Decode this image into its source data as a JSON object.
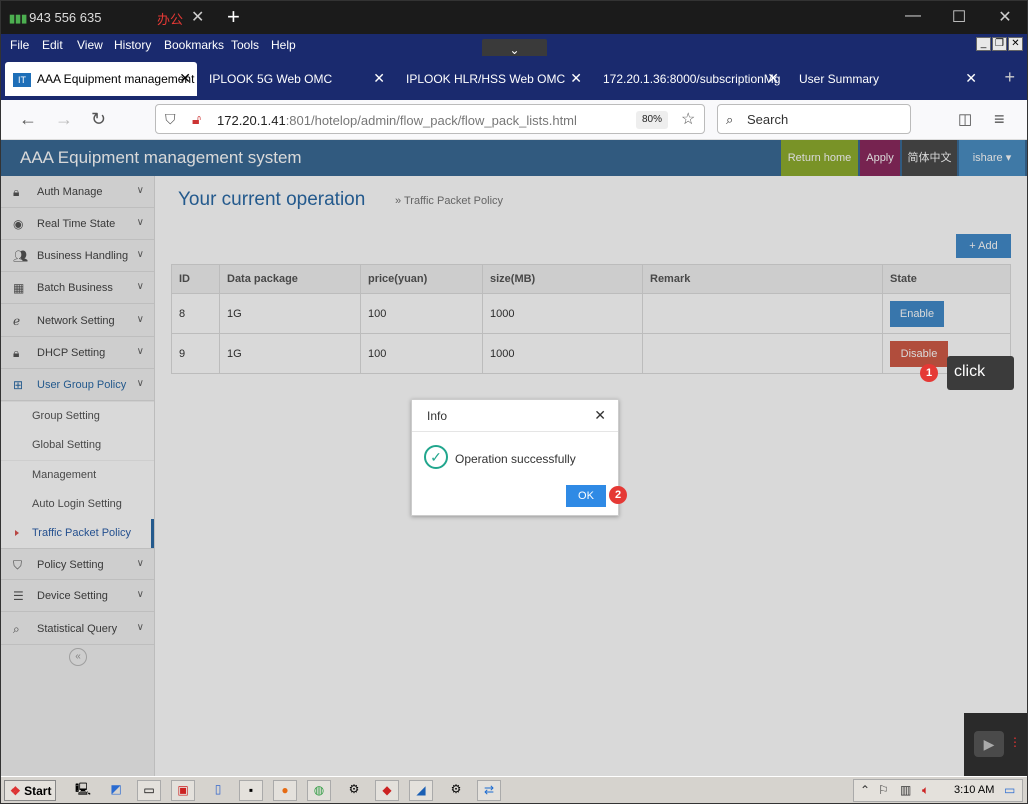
{
  "titlebar": {
    "signal": "943 556 635",
    "office": "办公"
  },
  "menu": [
    "File",
    "Edit",
    "View",
    "History",
    "Bookmarks",
    "Tools",
    "Help"
  ],
  "tabs": [
    {
      "label": "AAA Equipment management"
    },
    {
      "label": "IPLOOK 5G Web OMC"
    },
    {
      "label": "IPLOOK HLR/HSS Web OMC"
    },
    {
      "label": "172.20.1.36:8000/subscriptionMg"
    },
    {
      "label": "User Summary"
    }
  ],
  "url": {
    "host": "172.20.1.41",
    "rest": ":801/hotelop/admin/flow_pack/flow_pack_lists.html",
    "zoom": "80%"
  },
  "search": {
    "placeholder": "Search"
  },
  "app": {
    "title": "AAA Equipment management system",
    "header_buttons": [
      {
        "label": "Return home",
        "color": "#8fad2e"
      },
      {
        "label": "Apply",
        "color": "#8b2a5e"
      },
      {
        "label": "简体中文",
        "color": "#4a4a4a"
      },
      {
        "label": "ishare",
        "color": "#4a8fc4"
      }
    ]
  },
  "sidebar": {
    "items": [
      {
        "label": "Auth Manage",
        "icon": "lock-icon"
      },
      {
        "label": "Real Time State",
        "icon": "dashboard-icon"
      },
      {
        "label": "Business Handling",
        "icon": "users-icon"
      },
      {
        "label": "Batch Business",
        "icon": "grid-icon"
      },
      {
        "label": "Network Setting",
        "icon": "ie-icon"
      },
      {
        "label": "DHCP Setting",
        "icon": "lock-icon"
      },
      {
        "label": "User Group Policy",
        "icon": "sitemap-icon"
      }
    ],
    "subitems": [
      {
        "label": "Group Setting"
      },
      {
        "label": "Global Setting"
      },
      {
        "label": "Management"
      },
      {
        "label": "Auto Login Setting"
      },
      {
        "label": "Traffic Packet Policy"
      }
    ],
    "bottom_items": [
      {
        "label": "Policy Setting",
        "icon": "shield-icon"
      },
      {
        "label": "Device Setting",
        "icon": "list-icon"
      },
      {
        "label": "Statistical Query",
        "icon": "search-icon"
      }
    ]
  },
  "page": {
    "title": "Your current operation",
    "crumb": "» Traffic Packet Policy",
    "add_label": "+ Add"
  },
  "table": {
    "headers": [
      "ID",
      "Data package",
      "price(yuan)",
      "size(MB)",
      "Remark",
      "State"
    ],
    "rows": [
      {
        "id": "8",
        "package": "1G",
        "price": "100",
        "size": "1000",
        "remark": "",
        "state": "Enable"
      },
      {
        "id": "9",
        "package": "1G",
        "price": "100",
        "size": "1000",
        "remark": "",
        "state": "Disable"
      }
    ]
  },
  "annotation": {
    "badge1": "1",
    "tip": "click",
    "badge2": "2"
  },
  "modal": {
    "title": "Info",
    "message": "Operation successfully",
    "ok": "OK"
  },
  "taskbar": {
    "start": "Start",
    "clock": "3:10 AM"
  }
}
